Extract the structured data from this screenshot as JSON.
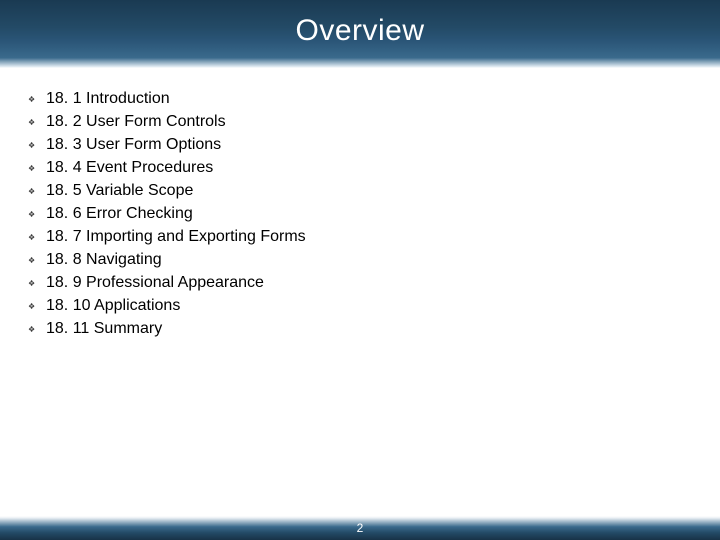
{
  "title": "Overview",
  "bullets": [
    "18. 1 Introduction",
    "18. 2 User Form Controls",
    "18. 3 User Form Options",
    "18. 4 Event Procedures",
    "18. 5 Variable Scope",
    "18. 6 Error Checking",
    "18. 7 Importing and Exporting Forms",
    "18. 8 Navigating",
    "18. 9 Professional Appearance",
    "18. 10 Applications",
    "18. 11 Summary"
  ],
  "page_number": "2"
}
